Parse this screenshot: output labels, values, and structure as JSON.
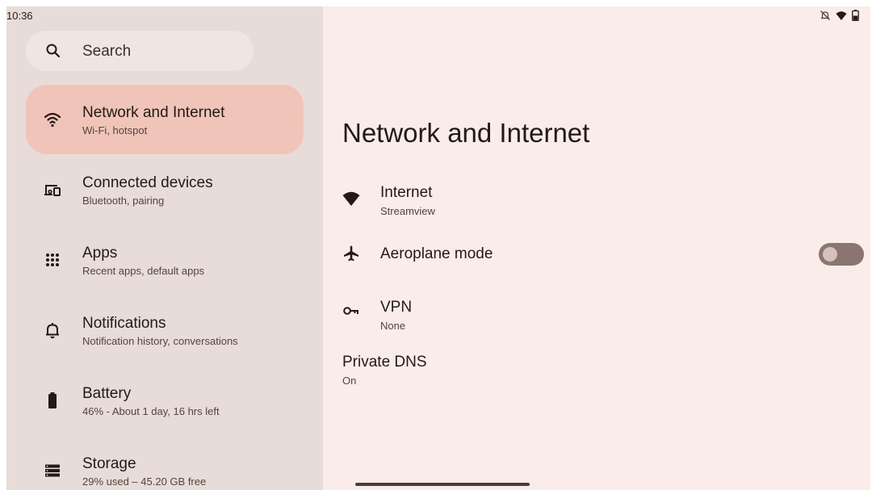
{
  "status_bar": {
    "time": "10:36",
    "icons": [
      "notifications-off-icon",
      "wifi-icon",
      "battery-icon"
    ]
  },
  "search": {
    "label": "Search",
    "icon": "search-icon"
  },
  "sidebar": {
    "items": [
      {
        "title": "Network and Internet",
        "subtitle": "Wi-Fi, hotspot",
        "icon": "wifi-icon",
        "selected": true
      },
      {
        "title": "Connected devices",
        "subtitle": "Bluetooth, pairing",
        "icon": "devices-icon"
      },
      {
        "title": "Apps",
        "subtitle": "Recent apps, default apps",
        "icon": "apps-grid-icon"
      },
      {
        "title": "Notifications",
        "subtitle": "Notification history, conversations",
        "icon": "bell-icon"
      },
      {
        "title": "Battery",
        "subtitle": "46% - About 1 day, 16 hrs left",
        "icon": "battery-icon"
      },
      {
        "title": "Storage",
        "subtitle": "29% used – 45.20 GB free",
        "icon": "storage-icon"
      }
    ]
  },
  "main": {
    "title": "Network and Internet",
    "prefs": [
      {
        "title": "Internet",
        "subtitle": "Streamview",
        "icon": "wifi-signal-icon"
      },
      {
        "title": "Aeroplane mode",
        "icon": "airplane-icon",
        "toggle_on": false
      },
      {
        "title": "VPN",
        "subtitle": "None",
        "icon": "vpn-key-icon"
      },
      {
        "title": "Private DNS",
        "subtitle": "On"
      }
    ]
  },
  "colors": {
    "background": "#faece8",
    "sidebar": "#e8dcd8",
    "selected": "#f0c4b8",
    "text": "#231917"
  }
}
